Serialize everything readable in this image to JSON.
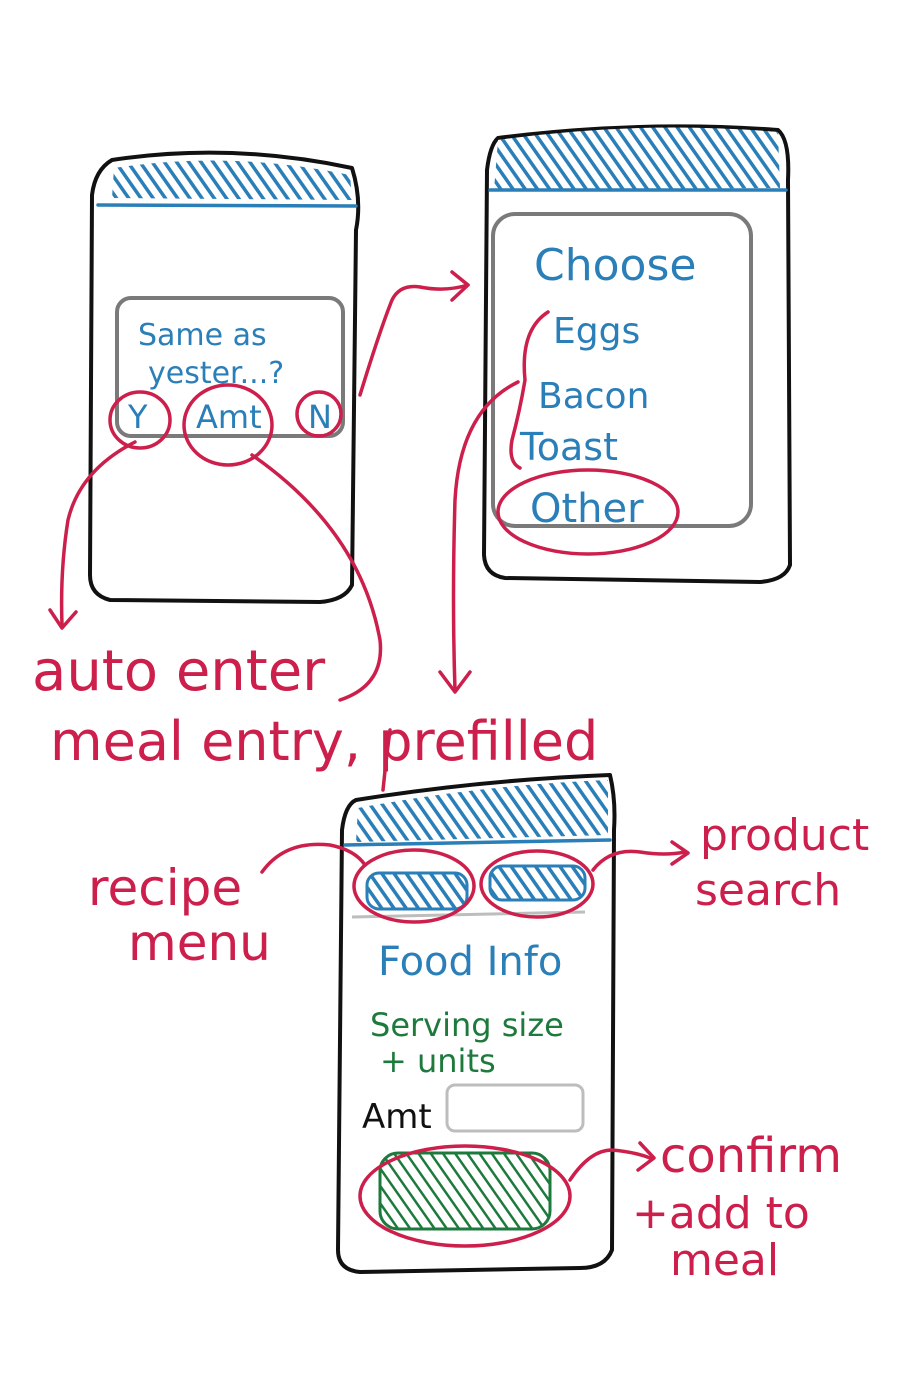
{
  "phone1": {
    "dialog_text_1": "Same as",
    "dialog_text_2": "yester...?",
    "yes_label": "Y",
    "amt_label": "Amt",
    "no_label": "N"
  },
  "phone2": {
    "title": "Choose",
    "options": [
      "Eggs",
      "Bacon",
      "Toast",
      "Other"
    ]
  },
  "phone3": {
    "food_info": "Food Info",
    "serving_line_1": "Serving size",
    "serving_line_2": "+ units",
    "amt_label": "Amt"
  },
  "annotations": {
    "auto_enter": "auto enter",
    "meal_entry": "meal entry, prefilled",
    "recipe_1": "recipe",
    "recipe_2": "menu",
    "product_1": "product",
    "product_2": "search",
    "confirm_1": "confirm",
    "confirm_2": "+add to",
    "confirm_3": "meal"
  },
  "colors": {
    "blue": "#2a7fb8",
    "red": "#cc1f4b",
    "green": "#1e7a3c",
    "outline": "#111111"
  }
}
